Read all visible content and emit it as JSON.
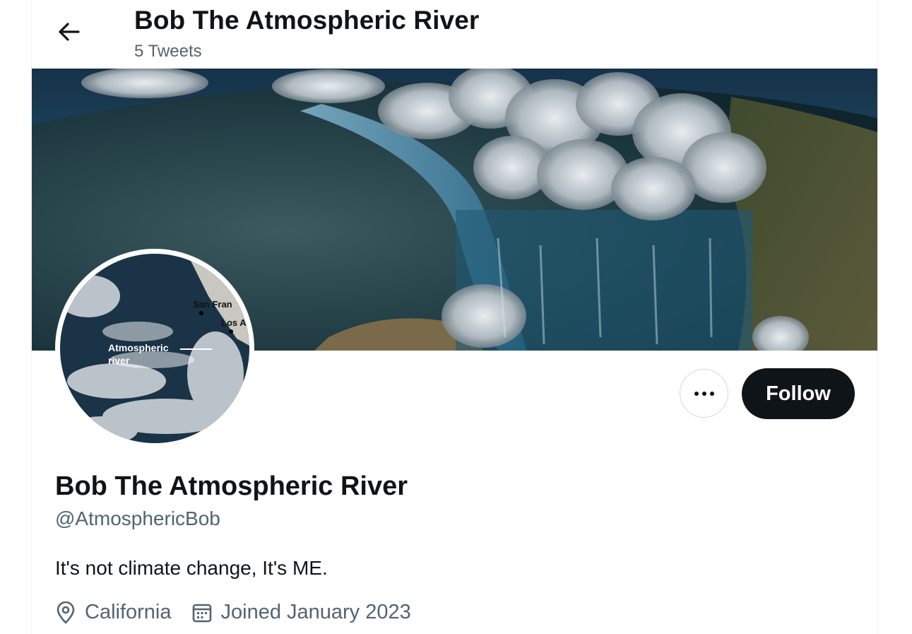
{
  "header": {
    "title": "Bob The Atmospheric River",
    "tweet_count": "5 Tweets"
  },
  "avatar": {
    "map_labels": {
      "city1": "San Fran",
      "city2": "Los A",
      "feature_line1": "Atmospheric",
      "feature_line2": "river"
    }
  },
  "actions": {
    "follow_label": "Follow"
  },
  "profile": {
    "name": "Bob The Atmospheric River",
    "handle": "@AtmosphericBob",
    "bio": "It's not climate change, It's ME.",
    "location": "California",
    "joined": "Joined January 2023"
  },
  "icons": {
    "back": "arrow-left-icon",
    "more": "more-horizontal-icon",
    "location": "location-pin-icon",
    "calendar": "calendar-icon"
  }
}
